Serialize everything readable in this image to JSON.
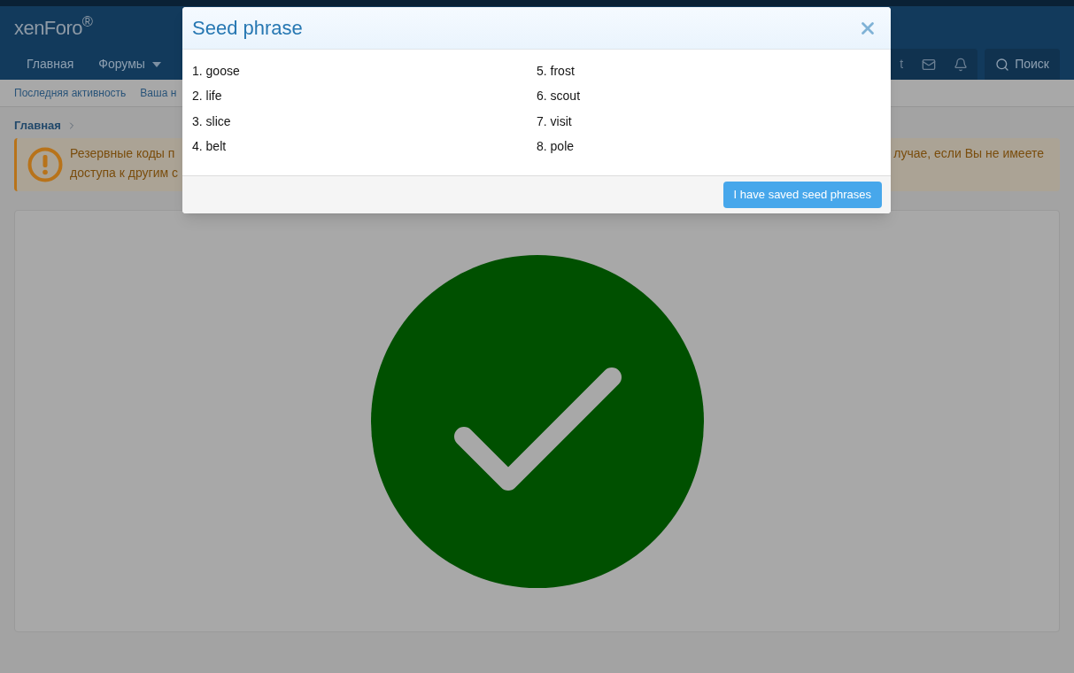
{
  "header": {
    "logo": "xenForo$^{®}$",
    "nav": [
      {
        "label": "Главная",
        "has_menu": false
      },
      {
        "label": "Форумы",
        "has_menu": true
      }
    ],
    "user_fragment": "t",
    "search_label": "Поиск"
  },
  "subnav": [
    "Последняя активность",
    "Ваша н"
  ],
  "breadcrumb": "Главная",
  "notice": {
    "left_lines": [
      "Резервные коды п",
      "доступа к другим с"
    ],
    "right_fragment": "лучае, если Вы не имеете"
  },
  "modal": {
    "title": "Seed phrase",
    "words": [
      "1. goose",
      "2. life",
      "3. slice",
      "4. belt",
      "5. frost",
      "6. scout",
      "7. visit",
      "8. pole"
    ],
    "button": "I have saved seed phrases"
  }
}
